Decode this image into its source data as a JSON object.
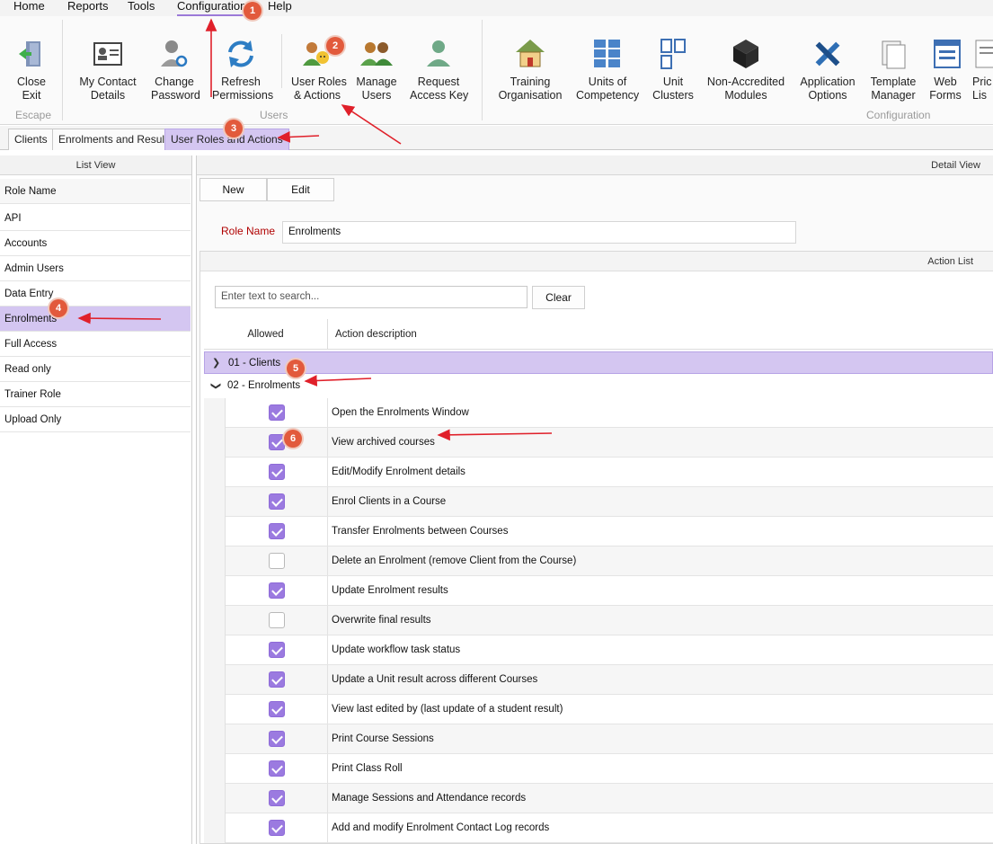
{
  "menu": {
    "items": [
      "Home",
      "Reports",
      "Tools",
      "Configuration",
      "Help"
    ]
  },
  "ribbon": {
    "escape": {
      "group_label": "Escape",
      "close": [
        "Close",
        "Exit"
      ]
    },
    "users": {
      "group_label": "Users",
      "buttons": [
        {
          "line1": "My Contact",
          "line2": "Details",
          "icon": "contact-card-icon"
        },
        {
          "line1": "Change",
          "line2": "Password",
          "icon": "user-key-icon"
        },
        {
          "line1": "Refresh",
          "line2": "Permissions",
          "icon": "refresh-icon"
        },
        {
          "line1": "User Roles",
          "line2": "& Actions",
          "icon": "user-roles-icon"
        },
        {
          "line1": "Manage",
          "line2": "Users",
          "icon": "users-group-icon"
        },
        {
          "line1": "Request",
          "line2": "Access Key",
          "icon": "request-key-icon"
        }
      ]
    },
    "configuration": {
      "group_label": "Configuration",
      "buttons": [
        {
          "line1": "Training",
          "line2": "Organisation",
          "icon": "house-icon"
        },
        {
          "line1": "Units of",
          "line2": "Competency",
          "icon": "grid-icon"
        },
        {
          "line1": "Unit",
          "line2": "Clusters",
          "icon": "clusters-icon"
        },
        {
          "line1": "Non-Accredited",
          "line2": "Modules",
          "icon": "cube-icon"
        },
        {
          "line1": "Application",
          "line2": "Options",
          "icon": "tools-icon"
        },
        {
          "line1": "Template",
          "line2": "Manager",
          "icon": "template-icon"
        },
        {
          "line1": "Web",
          "line2": "Forms",
          "icon": "web-form-icon"
        },
        {
          "line1": "Pric",
          "line2": "Lis",
          "icon": "price-list-icon"
        }
      ]
    }
  },
  "tabs": [
    "Clients",
    "Enrolments and Results",
    "User Roles and Actions"
  ],
  "list_view": {
    "title": "List View",
    "header": "Role Name",
    "roles": [
      "API",
      "Accounts",
      "Admin Users",
      "Data Entry",
      "Enrolments",
      "Full Access",
      "Read only",
      "Trainer Role",
      "Upload Only"
    ],
    "selected": "Enrolments"
  },
  "detail_view": {
    "title": "Detail View",
    "new_label": "New",
    "edit_label": "Edit",
    "role_name_label": "Role Name",
    "role_name_value": "Enrolments",
    "action_list": {
      "title": "Action List",
      "search_placeholder": "Enter text to search...",
      "clear_label": "Clear",
      "col_allowed": "Allowed",
      "col_description": "Action description",
      "groups": [
        "01 - Clients",
        "02 - Enrolments"
      ],
      "actions": [
        {
          "allowed": true,
          "description": "Open the Enrolments Window"
        },
        {
          "allowed": true,
          "description": "View archived courses"
        },
        {
          "allowed": true,
          "description": "Edit/Modify Enrolment details"
        },
        {
          "allowed": true,
          "description": "Enrol Clients in a Course"
        },
        {
          "allowed": true,
          "description": "Transfer Enrolments between Courses"
        },
        {
          "allowed": false,
          "description": "Delete an Enrolment (remove Client from the Course)"
        },
        {
          "allowed": true,
          "description": "Update Enrolment results"
        },
        {
          "allowed": false,
          "description": "Overwrite final results"
        },
        {
          "allowed": true,
          "description": "Update workflow task status"
        },
        {
          "allowed": true,
          "description": "Update a Unit result across different Courses"
        },
        {
          "allowed": true,
          "description": "View last edited by (last update of a student result)"
        },
        {
          "allowed": true,
          "description": "Print Course Sessions"
        },
        {
          "allowed": true,
          "description": "Print Class Roll"
        },
        {
          "allowed": true,
          "description": "Manage Sessions and Attendance records"
        },
        {
          "allowed": true,
          "description": "Add and modify Enrolment Contact Log records"
        }
      ]
    }
  },
  "annotations": [
    "1",
    "2",
    "3",
    "4",
    "5",
    "6"
  ],
  "colors": {
    "accent": "#9b7ae0",
    "selection": "#d4c6f1",
    "badge": "#e25a3c",
    "arrow": "#e0202a",
    "role_label": "#b00000"
  }
}
